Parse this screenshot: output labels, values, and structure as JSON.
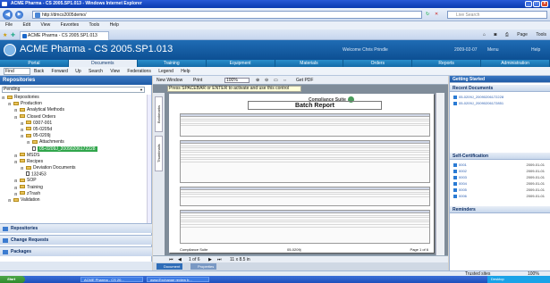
{
  "window": {
    "title": "ACME Pharma - CS 2005.SP1.013 - Windows Internet Explorer"
  },
  "browser": {
    "url": "http://dmcs2005demo/",
    "search_placeholder": "Live Search",
    "menu": [
      "File",
      "Edit",
      "View",
      "Favorites",
      "Tools",
      "Help"
    ],
    "tab_title": "ACME Pharma - CS 2005.SP1.013",
    "tools": [
      "Page",
      "Tools"
    ]
  },
  "app": {
    "title": "ACME Pharma - CS 2005.SP1.013",
    "welcome": "Welcome Chris Prindle",
    "date": "2009-02-07",
    "menu_label": "Menu",
    "help_label": "Help",
    "nav": [
      "Portal",
      "Documents",
      "Training",
      "Equipment",
      "Materials",
      "Orders",
      "Reports",
      "Administration"
    ],
    "active_nav": "Documents",
    "toolbar": {
      "find": "Find",
      "items": [
        "Back",
        "Forward",
        "Up",
        "Search",
        "View",
        "Federations",
        "Legend",
        "Help"
      ]
    }
  },
  "repositories": {
    "title": "Repositories",
    "filter": "Pending",
    "tree": [
      {
        "label": "Repositories",
        "level": 0,
        "type": "folder"
      },
      {
        "label": "Production",
        "level": 1,
        "type": "folder"
      },
      {
        "label": "Analytical Methods",
        "level": 2,
        "type": "folder"
      },
      {
        "label": "Closed Orders",
        "level": 2,
        "type": "folder"
      },
      {
        "label": "0307-001",
        "level": 3,
        "type": "folder"
      },
      {
        "label": "05-0205d",
        "level": 3,
        "type": "folder"
      },
      {
        "label": "05-0209j",
        "level": 3,
        "type": "folder"
      },
      {
        "label": "Attachments",
        "level": 4,
        "type": "folder"
      },
      {
        "label": "05-0209J_20090206172228",
        "level": 4,
        "type": "doc",
        "selected": true
      },
      {
        "label": "MSDS",
        "level": 2,
        "type": "folder"
      },
      {
        "label": "Recipes",
        "level": 2,
        "type": "folder"
      },
      {
        "label": "Deviation Documents",
        "level": 3,
        "type": "folder"
      },
      {
        "label": "132453",
        "level": 3,
        "type": "doc"
      },
      {
        "label": "SOP",
        "level": 2,
        "type": "folder"
      },
      {
        "label": "Training",
        "level": 2,
        "type": "folder"
      },
      {
        "label": "zTrash",
        "level": 2,
        "type": "folder"
      },
      {
        "label": "Validation",
        "level": 1,
        "type": "folder"
      }
    ],
    "sections": [
      "Repositories",
      "Change Requests",
      "Packages"
    ]
  },
  "viewer": {
    "toolbar": {
      "new_window": "New Window",
      "print": "Print",
      "zoom": "100%",
      "getpdf": "Get PDF"
    },
    "notice": "Press SPACEBAR or ENTER to activate and use this control",
    "side_tabs": [
      "Bookmarks",
      "Thumbnails"
    ],
    "page_nav": "1 of 6",
    "page_size": "11 x 8.5 in",
    "bottom_tabs": [
      "Document",
      "Properties"
    ],
    "report": {
      "company": "Compliance Suite",
      "title": "Batch Report",
      "sections": [
        "Batch Header Information",
        "Comments",
        "Ingredients",
        "Bill of Materials"
      ],
      "footer_left": "Compliance Suite",
      "footer_mid": "05-0209j",
      "footer_right": "Page 1 of 6"
    }
  },
  "right": {
    "getting_started": "Getting Started",
    "recent_title": "Recent Documents",
    "recent": [
      "05-0209J_20090206172228",
      "05-0209J_20090206172851"
    ],
    "self_cert_title": "Self-Certification",
    "self_cert": [
      {
        "id": "0001",
        "date": "2009-01-01"
      },
      {
        "id": "0002",
        "date": "2009-01-01"
      },
      {
        "id": "0003",
        "date": "2009-01-01"
      },
      {
        "id": "0004",
        "date": "2009-01-01"
      },
      {
        "id": "0005",
        "date": "2009-01-01"
      },
      {
        "id": "0006",
        "date": "2009-01-01"
      }
    ],
    "reminders_title": "Reminders"
  },
  "status": {
    "zone": "Trusted sites",
    "zoom": "100%"
  },
  "taskbar": {
    "start": "Start",
    "buttons": [
      "ACME Pharma - CS 20...",
      "www.Exchange review b..."
    ],
    "tray": "Desktop"
  }
}
